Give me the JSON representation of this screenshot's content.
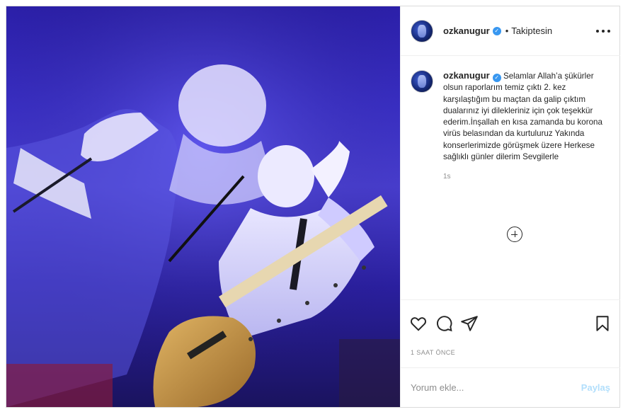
{
  "post": {
    "username": "ozkanugur",
    "follow_status": "Takiptesin",
    "dot": "•",
    "caption_text": "Selamlar Allah’a şükürler olsun raporlarım temiz çıktı 2. kez karşılaştığım bu maçtan da galip çıktım dualarınız iyi dilekleriniz için çok teşekkür ederim.İnşallah en kısa zamanda bu korona virüs belasından da kurtuluruz Yakında konserlerimizde görüşmek üzere Herkese sağlıklı günler dilerim Sevgilerle",
    "caption_age": "1s",
    "post_time": "1 SAAT ÖNCE"
  },
  "comment": {
    "placeholder": "Yorum ekle...",
    "share_label": "Paylaş"
  },
  "icons": {
    "like": "heart-icon",
    "comment": "comment-icon",
    "share": "paper-plane-icon",
    "save": "bookmark-icon",
    "more": "more-dots-icon",
    "verified": "verified-badge-icon",
    "load_more": "plus-circle-icon"
  },
  "colors": {
    "verified": "#3897f0",
    "share_disabled": "#b2dffc",
    "muted_text": "#8e8e8e",
    "border": "#dbdbdb"
  }
}
